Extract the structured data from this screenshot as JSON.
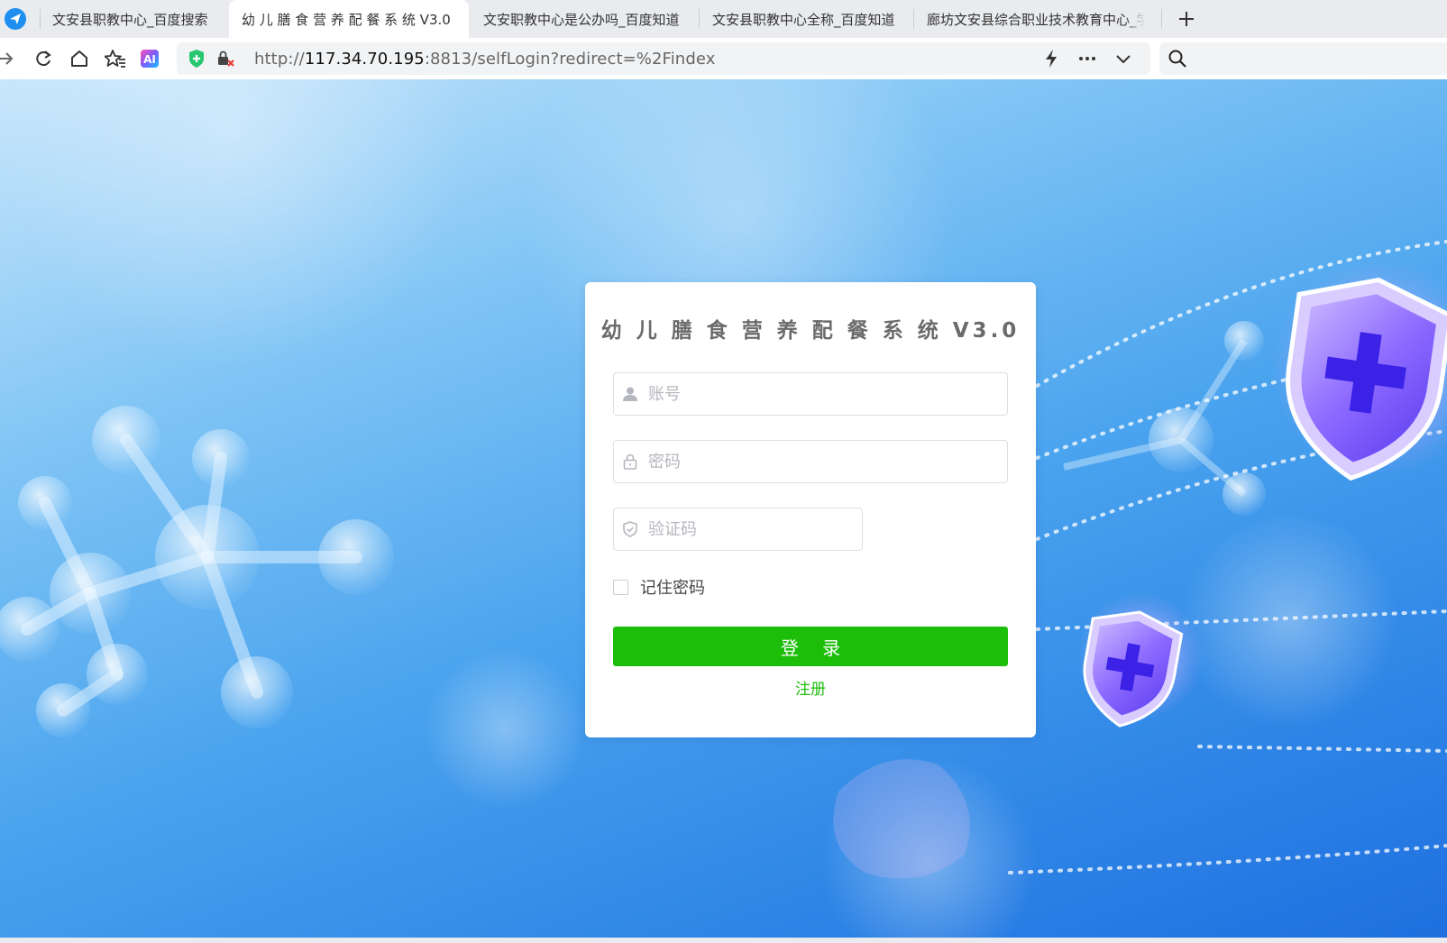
{
  "browser": {
    "tabs": [
      {
        "label": "文安县职教中心_百度搜索",
        "active": false
      },
      {
        "label": "幼 儿 膳 食 营 养 配 餐 系 统 V3.0",
        "active": true
      },
      {
        "label": "文安职教中心是公办吗_百度知道",
        "active": false
      },
      {
        "label": "文安县职教中心全称_百度知道",
        "active": false
      },
      {
        "label": "廊坊文安县综合职业技术教育中心_学",
        "active": false
      }
    ],
    "url": {
      "scheme": "http://",
      "host": "117.34.70.195",
      "rest": ":8813/selfLogin?redirect=%2Findex"
    },
    "ai_badge": "AI"
  },
  "login": {
    "title": "幼 儿 膳 食 营 养 配 餐 系 统 V3.0",
    "username_placeholder": "账号",
    "password_placeholder": "密码",
    "captcha_placeholder": "验证码",
    "remember_label": "记住密码",
    "login_button": "登 录",
    "register_link": "注册"
  },
  "colors": {
    "accent_green": "#1cbe0a",
    "background_blue": "#4aa3ee"
  }
}
